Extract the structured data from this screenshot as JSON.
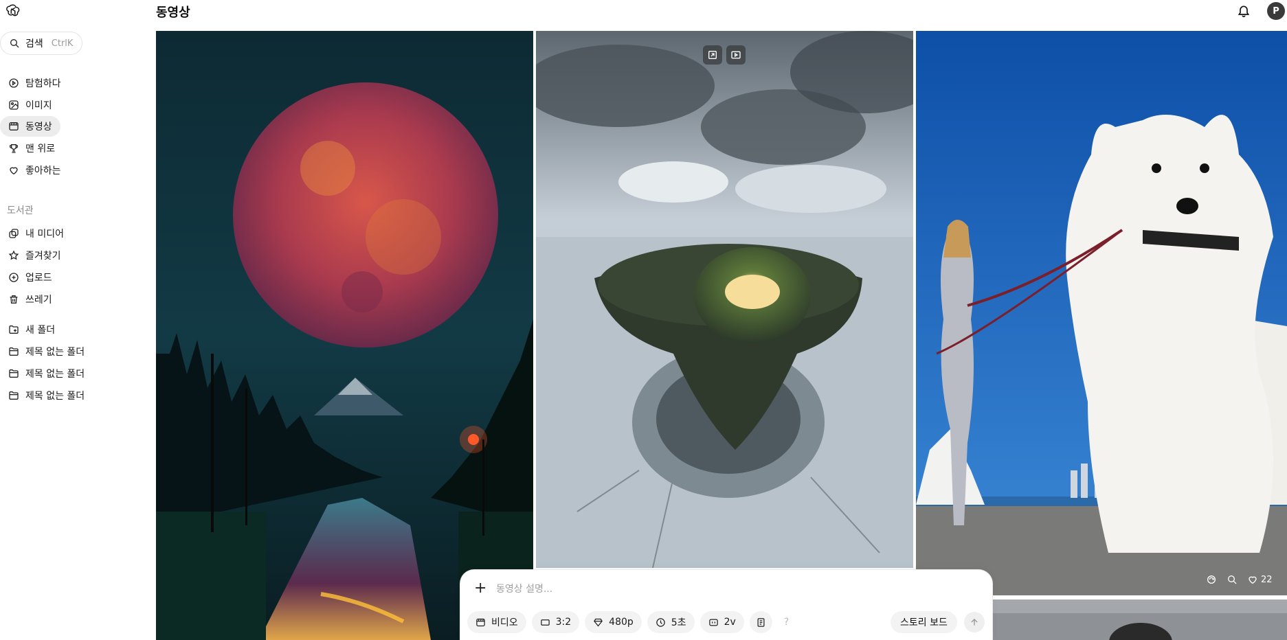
{
  "header": {
    "title": "동영상",
    "avatar_initial": "P"
  },
  "search": {
    "label": "검색",
    "shortcut": "CtrlK"
  },
  "sidebar": {
    "items": [
      {
        "label": "탐험하다",
        "icon": "compass-icon"
      },
      {
        "label": "이미지",
        "icon": "image-icon"
      },
      {
        "label": "동영상",
        "icon": "video-icon",
        "active": true
      },
      {
        "label": "맨 위로",
        "icon": "trophy-icon"
      },
      {
        "label": "좋아하는",
        "icon": "heart-icon"
      }
    ],
    "library_label": "도서관",
    "library_items": [
      {
        "label": "내 미디어",
        "icon": "media-icon"
      },
      {
        "label": "즐겨찾기",
        "icon": "star-icon"
      },
      {
        "label": "업로드",
        "icon": "upload-icon"
      },
      {
        "label": "쓰레기",
        "icon": "trash-icon"
      }
    ],
    "folders": [
      {
        "label": "새 폴더",
        "icon": "new-folder-icon"
      },
      {
        "label": "제목 없는 폴더",
        "icon": "folder-icon"
      },
      {
        "label": "제목 없는 폴더",
        "icon": "folder-icon"
      },
      {
        "label": "제목 없는 폴더",
        "icon": "folder-icon"
      }
    ]
  },
  "gallery": {
    "tile3_likes": "22"
  },
  "composer": {
    "placeholder": "동영상 설명...",
    "chips": {
      "type": "비디오",
      "ratio": "3:2",
      "resolution": "480p",
      "duration": "5초",
      "variants": "2v",
      "help": "?"
    },
    "storyboard": "스토리 보드"
  },
  "colors": {
    "accent_yellow": "#f5e96a",
    "active_bg": "#ececec"
  }
}
